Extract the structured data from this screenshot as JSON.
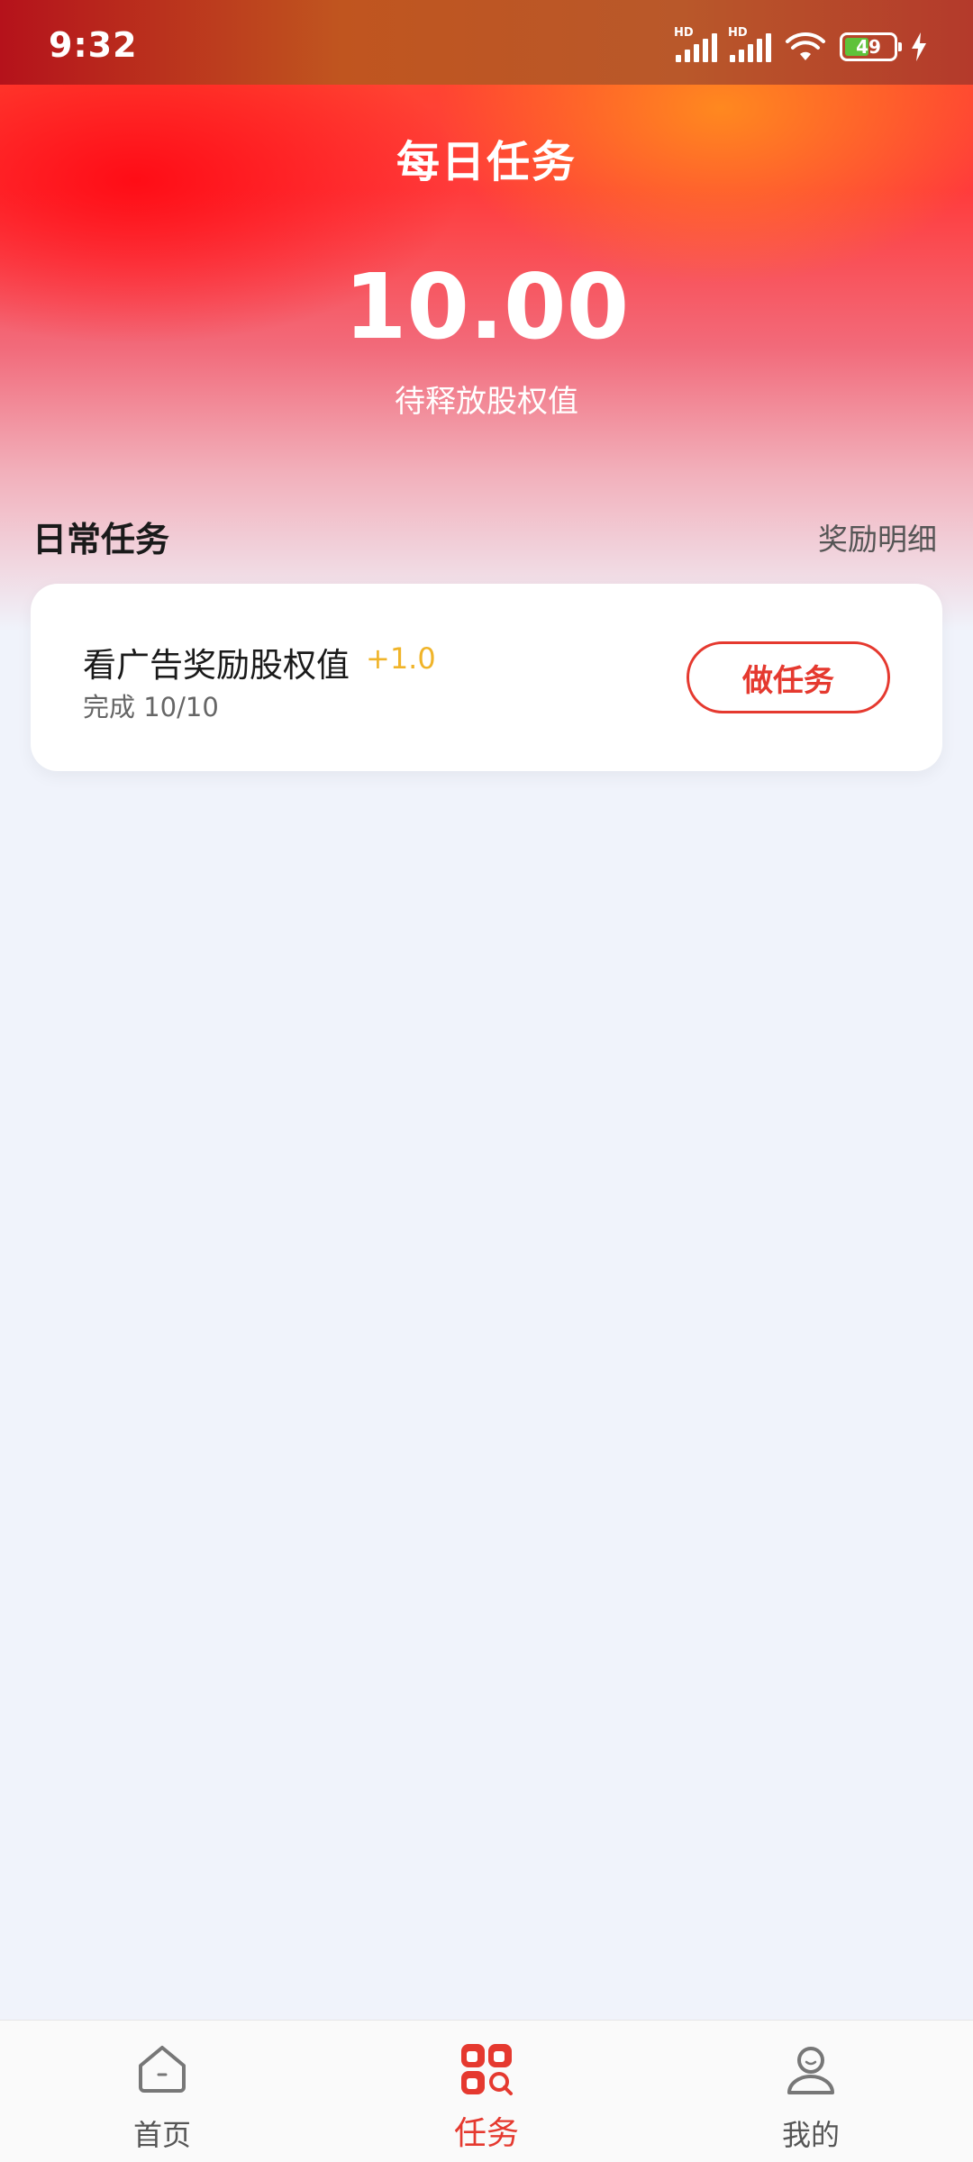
{
  "status_bar": {
    "time": "9:32",
    "signal1_tag": "HD",
    "signal2_tag": "HD",
    "battery_level": "49"
  },
  "header": {
    "title": "每日任务",
    "value": "10.00",
    "value_label": "待释放股权值"
  },
  "section": {
    "title": "日常任务",
    "link_label": "奖励明细"
  },
  "tasks": [
    {
      "name": "看广告奖励股权值",
      "bonus": "+1.0",
      "progress": "完成 10/10",
      "button_label": "做任务"
    }
  ],
  "bottom_nav": {
    "items": [
      {
        "label": "首页",
        "icon": "home-icon",
        "active": false
      },
      {
        "label": "任务",
        "icon": "tasks-icon",
        "active": true
      },
      {
        "label": "我的",
        "icon": "profile-icon",
        "active": false
      }
    ]
  },
  "colors": {
    "accent": "#e5392f",
    "bonus": "#f0b429",
    "background": "#f0f3fb"
  }
}
